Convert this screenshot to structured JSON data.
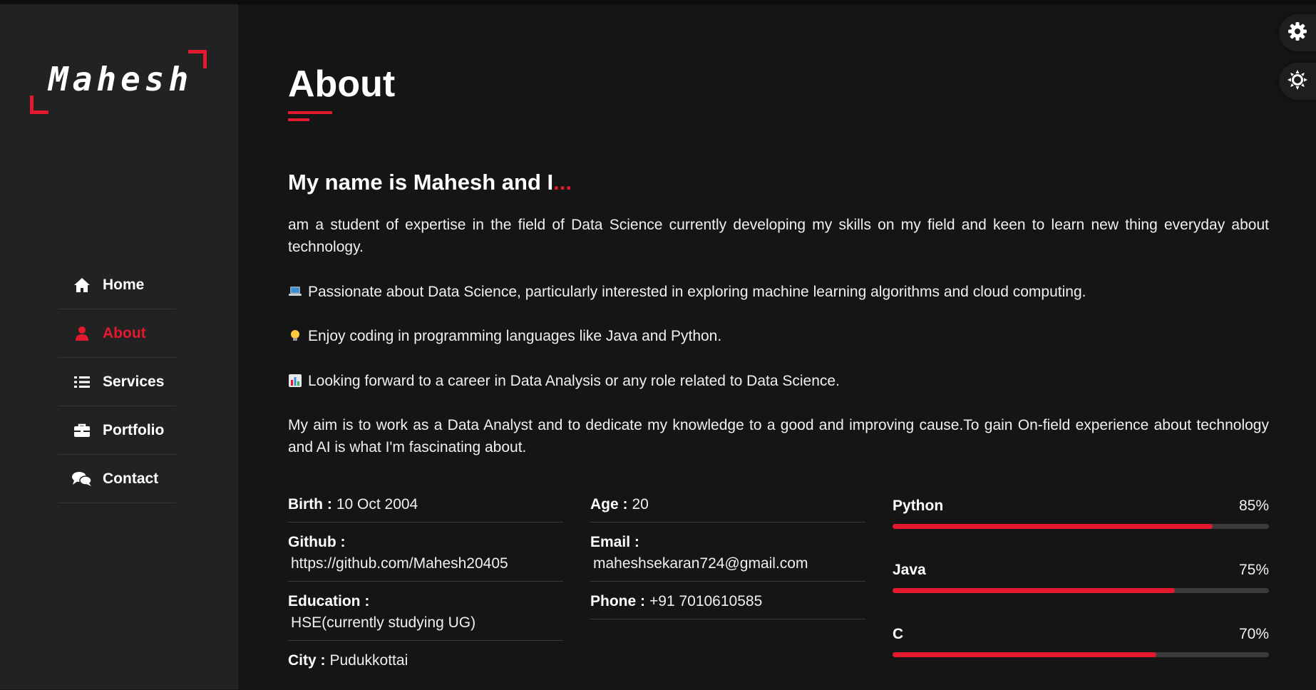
{
  "brand": {
    "logo_text": "Mahesh"
  },
  "nav": {
    "items": [
      {
        "label": "Home",
        "icon": "home-icon",
        "active": false
      },
      {
        "label": "About",
        "icon": "user-icon",
        "active": true
      },
      {
        "label": "Services",
        "icon": "list-icon",
        "active": false
      },
      {
        "label": "Portfolio",
        "icon": "briefcase-icon",
        "active": false
      },
      {
        "label": "Contact",
        "icon": "chat-icon",
        "active": false
      }
    ]
  },
  "about": {
    "title": "About",
    "subhead": "My name is Mahesh and I",
    "subhead_dots": "...",
    "paragraphs": [
      "am a student of expertise in the field of Data Science currently developing my skills on my field and keen to learn new thing everyday about technology.",
      "Passionate about Data Science, particularly interested in exploring machine learning algorithms and cloud computing.",
      "Enjoy coding in programming languages like Java and Python.",
      "Looking forward to a career in Data Analysis or any role related to Data Science.",
      "My aim is to work as a Data Analyst and to dedicate my knowledge to a good and improving cause.To gain On-field experience about technology and AI is what I'm fascinating about."
    ],
    "emoji_icons": [
      "laptop-icon",
      "lightbulb-icon",
      "bar-chart-icon"
    ]
  },
  "info": {
    "birth": {
      "label": "Birth :",
      "value": "10 Oct 2004"
    },
    "github": {
      "label": "Github :",
      "value": "https://github.com/Mahesh20405"
    },
    "education": {
      "label": "Education :",
      "value": "HSE(currently studying UG)"
    },
    "city": {
      "label": "City :",
      "value": "Pudukkottai"
    },
    "age": {
      "label": "Age :",
      "value": "20"
    },
    "email": {
      "label": "Email :",
      "value": "maheshsekaran724@gmail.com"
    },
    "phone": {
      "label": "Phone :",
      "value": "+91 7010610585"
    }
  },
  "skills": [
    {
      "name": "Python",
      "percent_label": "85%",
      "level": 85
    },
    {
      "name": "Java",
      "percent_label": "75%",
      "level": 75
    },
    {
      "name": "C",
      "percent_label": "70%",
      "level": 70
    }
  ],
  "floating_buttons": [
    {
      "icon": "gear-icon"
    },
    {
      "icon": "sun-icon"
    }
  ],
  "colors": {
    "accent": "#e3192f",
    "background": "#151515",
    "sidebar": "#222222"
  }
}
